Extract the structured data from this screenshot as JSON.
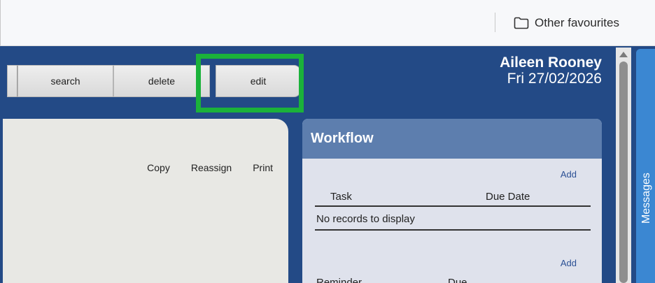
{
  "bookmarks": {
    "folder_label": "Other favourites"
  },
  "toolbar": {
    "search_label": "search",
    "delete_label": "delete",
    "edit_label": "edit"
  },
  "user": {
    "name": "Aileen Rooney",
    "date": "Fri 27/02/2026"
  },
  "main": {
    "actions": [
      "Copy",
      "Reassign",
      "Print"
    ]
  },
  "workflow": {
    "title": "Workflow",
    "add_label": "Add",
    "tasks_columns": [
      "Task",
      "Due Date"
    ],
    "empty_text": "No records to display",
    "reminders_add_label": "Add",
    "reminders_columns": [
      "Reminder",
      "Due"
    ]
  },
  "side_tab": {
    "label": "Messages"
  },
  "colors": {
    "header": "#234a86",
    "workflow_header": "#5d7eae",
    "highlight": "#1bb23a",
    "messages_tab": "#3b87d2"
  }
}
